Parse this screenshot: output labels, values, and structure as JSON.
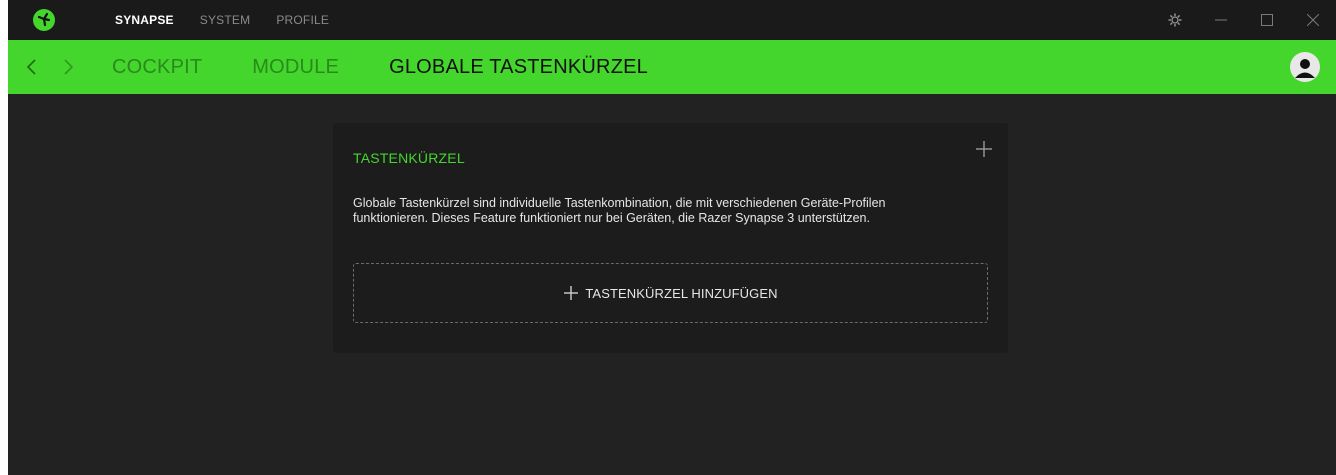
{
  "app": {
    "accent_color": "#44d62c",
    "logo_icon": "razer-logo-icon"
  },
  "top_tabs": [
    {
      "label": "SYNAPSE",
      "active": true
    },
    {
      "label": "SYSTEM",
      "active": false
    },
    {
      "label": "PROFILE",
      "active": false
    }
  ],
  "window_controls": {
    "settings_icon": "gear-icon",
    "minimize_icon": "minimize-icon",
    "maximize_icon": "maximize-icon",
    "close_icon": "close-icon"
  },
  "navbar": {
    "back_icon": "chevron-left-icon",
    "forward_icon": "chevron-right-icon",
    "items": [
      {
        "label": "COCKPIT",
        "active": false
      },
      {
        "label": "MODULE",
        "active": false
      },
      {
        "label": "GLOBALE TASTENKÜRZEL",
        "active": true
      }
    ],
    "avatar_icon": "user-avatar-icon"
  },
  "card": {
    "title": "TASTENKÜRZEL",
    "add_icon": "plus-icon",
    "description_line1": "Globale Tastenkürzel sind individuelle Tastenkombination, die mit verschiedenen Geräte-Profilen",
    "description_line2": "funktionieren. Dieses Feature funktioniert nur bei Geräten, die Razer Synapse 3 unterstützen.",
    "add_button_label": "TASTENKÜRZEL HINZUFÜGEN"
  }
}
